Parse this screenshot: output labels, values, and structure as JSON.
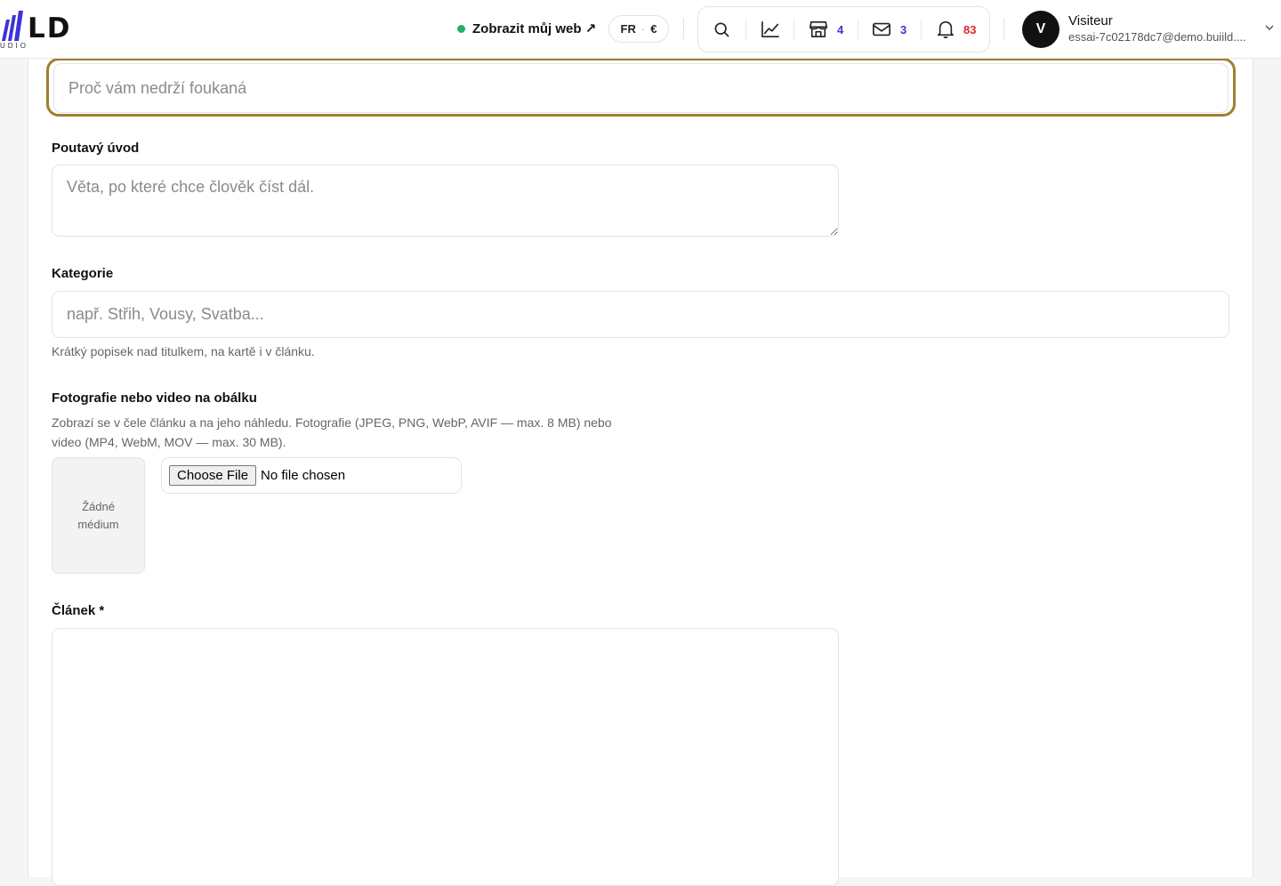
{
  "header": {
    "logo": {
      "word": "LD",
      "sub": "UDIO"
    },
    "view_site": "Zobrazit můj web ↗",
    "lang": {
      "code": "FR",
      "sep": "·",
      "currency": "€"
    },
    "icons": [
      {
        "name": "search",
        "count": ""
      },
      {
        "name": "analytics",
        "count": ""
      },
      {
        "name": "store",
        "count": "4"
      },
      {
        "name": "mail",
        "count": "3"
      },
      {
        "name": "bell",
        "count": "83"
      }
    ],
    "user": {
      "initial": "V",
      "name": "Visiteur",
      "email": "essai-7c02178dc7@demo.buiild...."
    },
    "colors": {
      "online_dot": "#22b35e",
      "badge_blue": "#3b34d6",
      "badge_red": "#e02424"
    }
  },
  "form": {
    "title": {
      "placeholder": "Proč vám nedrží foukaná",
      "value": "",
      "focus_color": "#a07f2e"
    },
    "intro": {
      "label": "Poutavý úvod",
      "placeholder": "Věta, po které chce člověk číst dál."
    },
    "category": {
      "label": "Kategorie",
      "placeholder": "např. Střih, Vousy, Svatba...",
      "help": "Krátký popisek nad titulkem, na kartě i v článku."
    },
    "cover": {
      "label": "Fotografie nebo video na obálku",
      "help_line1": "Zobrazí se v čele článku a na jeho náhledu. Fotografie (JPEG, PNG, WebP, AVIF — max. 8 MB) nebo",
      "help_line2": "video (MP4, WebM, MOV — max. 30 MB).",
      "empty": "Žádné médium",
      "choose_file": "Choose File",
      "file_status": "No file chosen"
    },
    "article": {
      "label": "Článek *"
    }
  }
}
